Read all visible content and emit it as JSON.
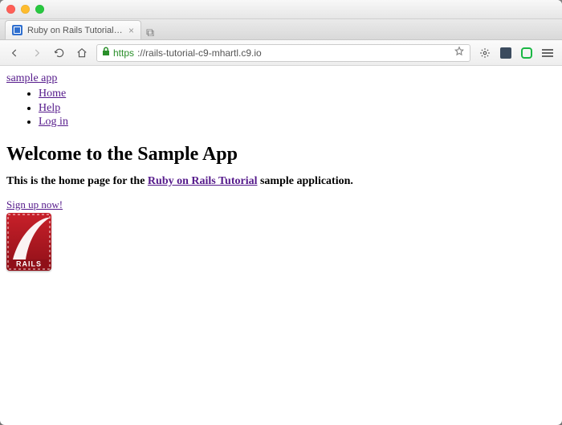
{
  "browser": {
    "tab_title": "Ruby on Rails Tutorial Sam",
    "url_scheme": "https",
    "url_rest": "://rails-tutorial-c9-mhartl.c9.io"
  },
  "content": {
    "brand_link": "sample app",
    "nav": [
      "Home",
      "Help",
      "Log in"
    ],
    "heading": "Welcome to the Sample App",
    "lead_prefix": "This is the home page for the ",
    "lead_link": "Ruby on Rails Tutorial",
    "lead_suffix": " sample application.",
    "signup_link": "Sign up now!",
    "logo_text": "RAILS"
  }
}
